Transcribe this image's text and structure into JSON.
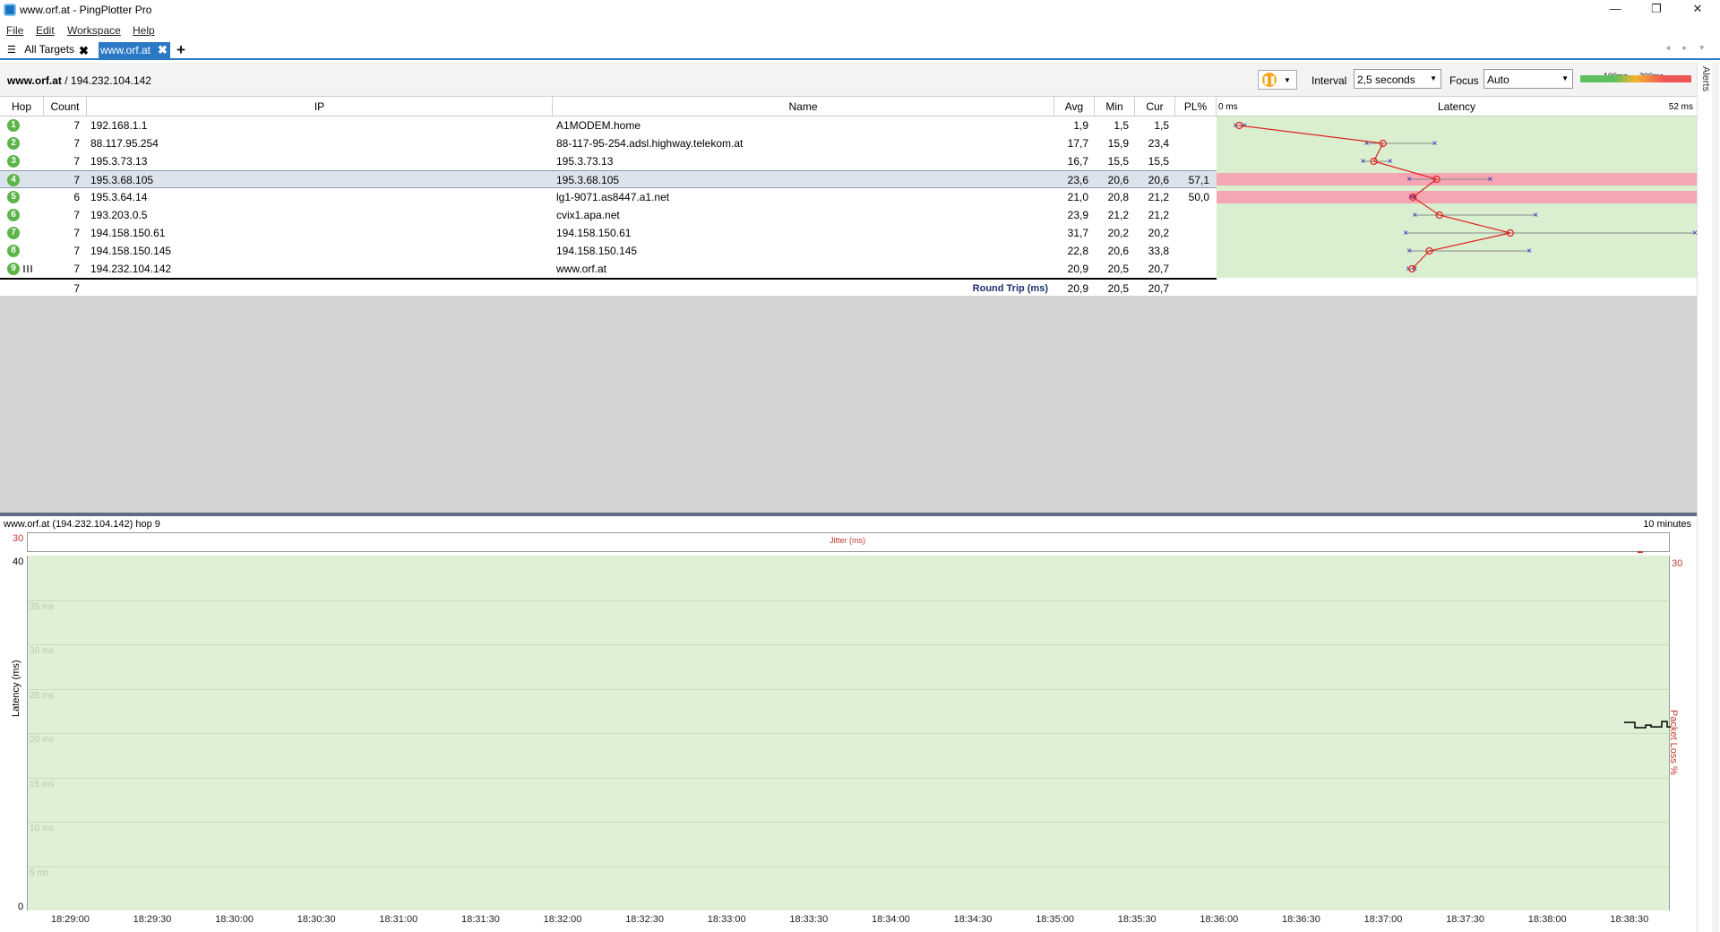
{
  "window": {
    "title": "www.orf.at - PingPlotter Pro",
    "minimize": "—",
    "restore": "❐",
    "close": "✕"
  },
  "menu": [
    "File",
    "Edit",
    "Workspace",
    "Help"
  ],
  "tabs": {
    "all_targets": "All Targets",
    "active": "www.orf.at",
    "close": "✖",
    "add": "+",
    "nav": "◂ ▸ ▾"
  },
  "alerts_label": "Alerts",
  "toolbar": {
    "target_host": "www.orf.at",
    "target_ip": " / 194.232.104.142",
    "interval_label": "Interval",
    "interval_value": "2,5 seconds",
    "focus_label": "Focus",
    "focus_value": "Auto",
    "scale_100": "100ms",
    "scale_200": "200ms"
  },
  "grid": {
    "columns": [
      "Hop",
      "Count",
      "IP",
      "Name",
      "Avg",
      "Min",
      "Cur",
      "PL%",
      "Latency"
    ],
    "latency_min_label": "0 ms",
    "latency_max_label": "52 ms",
    "latency_max_ms": 52,
    "rows": [
      {
        "hop": "1",
        "count": "7",
        "ip": "192.168.1.1",
        "name": "A1MODEM.home",
        "avg": "1,9",
        "min": "1,5",
        "cur": "1,5",
        "pl": "",
        "avg_v": 1.9,
        "min_v": 1.5,
        "max_v": 2.5,
        "pl_v": 0
      },
      {
        "hop": "2",
        "count": "7",
        "ip": "88.117.95.254",
        "name": "88-117-95-254.adsl.highway.telekom.at",
        "avg": "17,7",
        "min": "15,9",
        "cur": "23,4",
        "pl": "",
        "avg_v": 17.7,
        "min_v": 15.9,
        "max_v": 23.4,
        "pl_v": 0
      },
      {
        "hop": "3",
        "count": "7",
        "ip": "195.3.73.13",
        "name": "195.3.73.13",
        "avg": "16,7",
        "min": "15,5",
        "cur": "15,5",
        "pl": "",
        "avg_v": 16.7,
        "min_v": 15.5,
        "max_v": 18.5,
        "pl_v": 0
      },
      {
        "hop": "4",
        "count": "7",
        "ip": "195.3.68.105",
        "name": "195.3.68.105",
        "avg": "23,6",
        "min": "20,6",
        "cur": "20,6",
        "pl": "57,1",
        "avg_v": 23.6,
        "min_v": 20.6,
        "max_v": 29.5,
        "pl_v": 57.1
      },
      {
        "hop": "5",
        "count": "6",
        "ip": "195.3.64.14",
        "name": "lg1-9071.as8447.a1.net",
        "avg": "21,0",
        "min": "20,8",
        "cur": "21,2",
        "pl": "50,0",
        "avg_v": 21.0,
        "min_v": 20.8,
        "max_v": 21.2,
        "pl_v": 50.0
      },
      {
        "hop": "6",
        "count": "7",
        "ip": "193.203.0.5",
        "name": "cvix1.apa.net",
        "avg": "23,9",
        "min": "21,2",
        "cur": "21,2",
        "pl": "",
        "avg_v": 23.9,
        "min_v": 21.2,
        "max_v": 34.5,
        "pl_v": 0
      },
      {
        "hop": "7",
        "count": "7",
        "ip": "194.158.150.61",
        "name": "194.158.150.61",
        "avg": "31,7",
        "min": "20,2",
        "cur": "20,2",
        "pl": "",
        "avg_v": 31.7,
        "min_v": 20.2,
        "max_v": 52,
        "pl_v": 0
      },
      {
        "hop": "8",
        "count": "7",
        "ip": "194.158.150.145",
        "name": "194.158.150.145",
        "avg": "22,8",
        "min": "20,6",
        "cur": "33,8",
        "pl": "",
        "avg_v": 22.8,
        "min_v": 20.6,
        "max_v": 33.8,
        "pl_v": 0
      },
      {
        "hop": "9",
        "count": "7",
        "ip": "194.232.104.142",
        "name": "www.orf.at",
        "avg": "20,9",
        "min": "20,5",
        "cur": "20,7",
        "pl": "",
        "avg_v": 20.9,
        "min_v": 20.5,
        "max_v": 21.2,
        "pl_v": 0
      }
    ],
    "summary": {
      "count": "7",
      "label": "Round Trip (ms)",
      "avg": "20,9",
      "min": "20,5",
      "cur": "20,7"
    }
  },
  "lower": {
    "header": "www.orf.at (194.232.104.142) hop 9",
    "timespan": "10 minutes",
    "jitter_title": "Jitter (ms)",
    "jitter_max": "30",
    "y_max": "40",
    "y_min": "0",
    "pl_max": "30",
    "ylabel": "Latency (ms)",
    "pl_label": "Packet Loss %",
    "ms_labels": [
      "35 ms",
      "30 ms",
      "25 ms",
      "20 ms",
      "15 ms",
      "10 ms",
      "5 ms"
    ],
    "x_ticks": [
      "18:29:00",
      "18:29:30",
      "18:30:00",
      "18:30:30",
      "18:31:00",
      "18:31:30",
      "18:32:00",
      "18:32:30",
      "18:33:00",
      "18:33:30",
      "18:34:00",
      "18:34:30",
      "18:35:00",
      "18:35:30",
      "18:36:00",
      "18:36:30",
      "18:37:00",
      "18:37:30",
      "18:38:00",
      "18:38:30"
    ]
  },
  "chart_data": {
    "type": "line",
    "title": "",
    "xlabel": "",
    "ylabel": "Latency (ms)",
    "ylim": [
      0,
      40
    ],
    "x_range": [
      "18:29:00",
      "18:38:45"
    ],
    "series": [
      {
        "values": [
          21.2,
          21.2,
          20.6,
          20.6,
          20.9,
          20.7,
          20.7,
          21.3,
          20.7
        ]
      }
    ]
  },
  "colors": {
    "accent": "#2b78c5",
    "latency_bg": "#d9efd0",
    "loss": "#f4a6b3",
    "avg_line": "#e02020",
    "minmax_x": "#2424c0"
  }
}
